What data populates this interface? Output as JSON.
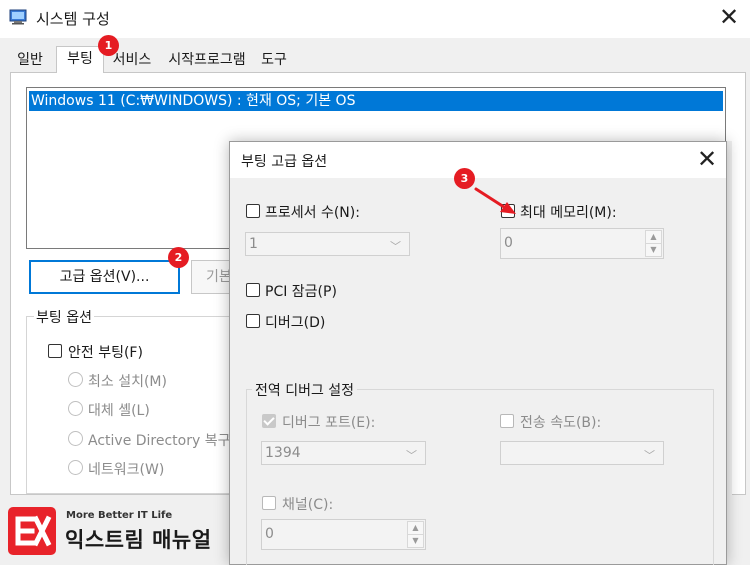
{
  "main_window": {
    "title": "시스템 구성",
    "close_glyph": "✕",
    "icon": "msconfig-icon",
    "tabs": [
      "일반",
      "부팅",
      "서비스",
      "시작프로그램",
      "도구"
    ],
    "os_list_item": "Windows 11 (C:₩WINDOWS) : 현재 OS; 기본 OS",
    "advanced_button": "고급 옵션(V)...",
    "default_button": "기본",
    "boot_options": {
      "title": "부팅 옵션",
      "safe_boot": "안전 부팅(F)",
      "radios": [
        "최소 설치(M)",
        "대체 셸(L)",
        "Active Directory 복구(",
        "네트워크(W)"
      ]
    }
  },
  "dialog": {
    "title": "부팅 고급 옵션",
    "close_glyph": "✕",
    "processors_label": "프로세서 수(N):",
    "processors_value": "1",
    "max_memory_label": "최대 메모리(M):",
    "max_memory_value": "0",
    "pci_lock_label": "PCI 잠금(P)",
    "debug_label": "디버그(D)",
    "global_debug": {
      "title": "전역 디버그 설정",
      "debug_port_label": "디버그 포트(E):",
      "debug_port_checked": true,
      "debug_port_value": "1394",
      "baud_rate_label": "전송 속도(B):",
      "baud_rate_value": "",
      "channel_label": "채널(C):",
      "channel_value": "0"
    }
  },
  "annotations": {
    "badges": [
      "1",
      "2",
      "3"
    ],
    "accent_color": "#e51c23"
  },
  "watermark": {
    "tagline": "More Better IT Life",
    "name": "익스트림 매뉴얼",
    "mark": "EX",
    "color": "#e8232a"
  },
  "colors": {
    "selection": "#0078d7",
    "window_bg": "#f0f0f0"
  }
}
